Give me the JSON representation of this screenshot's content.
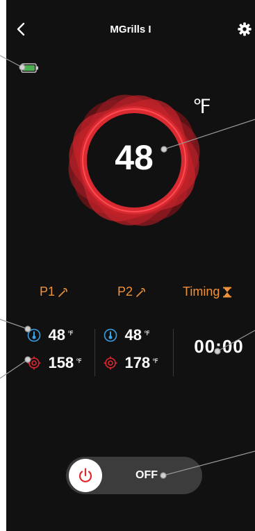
{
  "header": {
    "title": "MGrills I"
  },
  "icons": {
    "back": "chevron-left-icon",
    "settings": "gear-icon",
    "battery": "battery-icon",
    "probe": "probe-icon",
    "hourglass": "hourglass-icon",
    "thermometer": "thermometer-icon",
    "target": "target-icon",
    "power": "power-icon"
  },
  "grill": {
    "unit": "℉",
    "temperature": "48"
  },
  "probes": [
    {
      "label": "P1",
      "current_temp": "48",
      "current_unit": "℉",
      "target_temp": "158",
      "target_unit": "℉"
    },
    {
      "label": "P2",
      "current_temp": "48",
      "current_unit": "℉",
      "target_temp": "178",
      "target_unit": "℉"
    }
  ],
  "timing": {
    "label": "Timing",
    "value": "00:00"
  },
  "power": {
    "state_label": "OFF"
  },
  "colors": {
    "background": "#111111",
    "accent_orange": "#f0923a",
    "accent_red": "#e0262e",
    "thermo_blue": "#3aa0e8",
    "battery_green": "#4caf50"
  }
}
